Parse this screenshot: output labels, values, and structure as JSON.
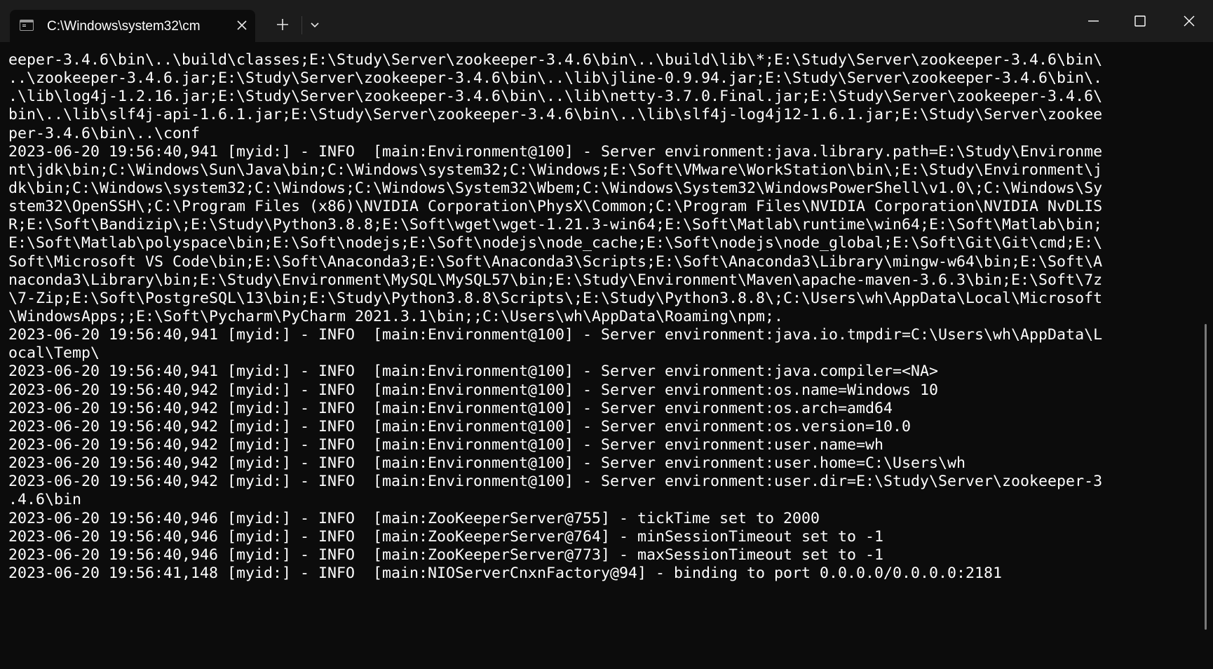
{
  "tab": {
    "title": "C:\\Windows\\system32\\cm"
  },
  "terminal": {
    "lines": [
      "eeper-3.4.6\\bin\\..\\build\\classes;E:\\Study\\Server\\zookeeper-3.4.6\\bin\\..\\build\\lib\\*;E:\\Study\\Server\\zookeeper-3.4.6\\bin\\",
      "..\\zookeeper-3.4.6.jar;E:\\Study\\Server\\zookeeper-3.4.6\\bin\\..\\lib\\jline-0.9.94.jar;E:\\Study\\Server\\zookeeper-3.4.6\\bin\\.",
      ".\\lib\\log4j-1.2.16.jar;E:\\Study\\Server\\zookeeper-3.4.6\\bin\\..\\lib\\netty-3.7.0.Final.jar;E:\\Study\\Server\\zookeeper-3.4.6\\",
      "bin\\..\\lib\\slf4j-api-1.6.1.jar;E:\\Study\\Server\\zookeeper-3.4.6\\bin\\..\\lib\\slf4j-log4j12-1.6.1.jar;E:\\Study\\Server\\zookee",
      "per-3.4.6\\bin\\..\\conf",
      "2023-06-20 19:56:40,941 [myid:] - INFO  [main:Environment@100] - Server environment:java.library.path=E:\\Study\\Environme",
      "nt\\jdk\\bin;C:\\Windows\\Sun\\Java\\bin;C:\\Windows\\system32;C:\\Windows;E:\\Soft\\VMware\\WorkStation\\bin\\;E:\\Study\\Environment\\j",
      "dk\\bin;C:\\Windows\\system32;C:\\Windows;C:\\Windows\\System32\\Wbem;C:\\Windows\\System32\\WindowsPowerShell\\v1.0\\;C:\\Windows\\Sy",
      "stem32\\OpenSSH\\;C:\\Program Files (x86)\\NVIDIA Corporation\\PhysX\\Common;C:\\Program Files\\NVIDIA Corporation\\NVIDIA NvDLIS",
      "R;E:\\Soft\\Bandizip\\;E:\\Study\\Python3.8.8;E:\\Soft\\wget\\wget-1.21.3-win64;E:\\Soft\\Matlab\\runtime\\win64;E:\\Soft\\Matlab\\bin;",
      "E:\\Soft\\Matlab\\polyspace\\bin;E:\\Soft\\nodejs;E:\\Soft\\nodejs\\node_cache;E:\\Soft\\nodejs\\node_global;E:\\Soft\\Git\\Git\\cmd;E:\\",
      "Soft\\Microsoft VS Code\\bin;E:\\Soft\\Anaconda3;E:\\Soft\\Anaconda3\\Scripts;E:\\Soft\\Anaconda3\\Library\\mingw-w64\\bin;E:\\Soft\\A",
      "naconda3\\Library\\bin;E:\\Study\\Environment\\MySQL\\MySQL57\\bin;E:\\Study\\Environment\\Maven\\apache-maven-3.6.3\\bin;E:\\Soft\\7z",
      "\\7-Zip;E:\\Soft\\PostgreSQL\\13\\bin;E:\\Study\\Python3.8.8\\Scripts\\;E:\\Study\\Python3.8.8\\;C:\\Users\\wh\\AppData\\Local\\Microsoft",
      "\\WindowsApps;;E:\\Soft\\Pycharm\\PyCharm 2021.3.1\\bin;;C:\\Users\\wh\\AppData\\Roaming\\npm;.",
      "2023-06-20 19:56:40,941 [myid:] - INFO  [main:Environment@100] - Server environment:java.io.tmpdir=C:\\Users\\wh\\AppData\\L",
      "ocal\\Temp\\",
      "2023-06-20 19:56:40,941 [myid:] - INFO  [main:Environment@100] - Server environment:java.compiler=<NA>",
      "2023-06-20 19:56:40,942 [myid:] - INFO  [main:Environment@100] - Server environment:os.name=Windows 10",
      "2023-06-20 19:56:40,942 [myid:] - INFO  [main:Environment@100] - Server environment:os.arch=amd64",
      "2023-06-20 19:56:40,942 [myid:] - INFO  [main:Environment@100] - Server environment:os.version=10.0",
      "2023-06-20 19:56:40,942 [myid:] - INFO  [main:Environment@100] - Server environment:user.name=wh",
      "2023-06-20 19:56:40,942 [myid:] - INFO  [main:Environment@100] - Server environment:user.home=C:\\Users\\wh",
      "2023-06-20 19:56:40,942 [myid:] - INFO  [main:Environment@100] - Server environment:user.dir=E:\\Study\\Server\\zookeeper-3",
      ".4.6\\bin",
      "2023-06-20 19:56:40,946 [myid:] - INFO  [main:ZooKeeperServer@755] - tickTime set to 2000",
      "2023-06-20 19:56:40,946 [myid:] - INFO  [main:ZooKeeperServer@764] - minSessionTimeout set to -1",
      "2023-06-20 19:56:40,946 [myid:] - INFO  [main:ZooKeeperServer@773] - maxSessionTimeout set to -1",
      "2023-06-20 19:56:41,148 [myid:] - INFO  [main:NIOServerCnxnFactory@94] - binding to port 0.0.0.0/0.0.0.0:2181"
    ]
  }
}
